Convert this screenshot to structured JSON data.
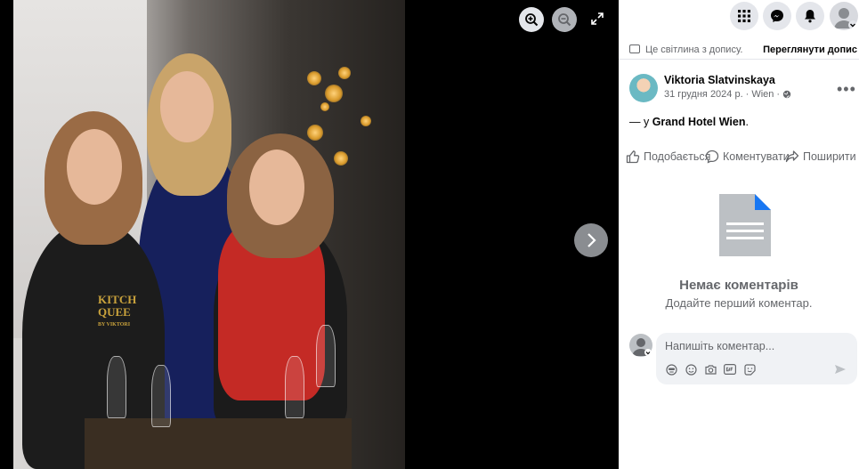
{
  "viewer": {
    "controls": {
      "zoom_in_icon": "zoom-in-icon",
      "zoom_out_icon": "zoom-out-icon",
      "fullscreen_icon": "fullscreen-icon",
      "next_icon": "chevron-right-icon"
    },
    "photo_sign": {
      "brand_line1": "KITCH",
      "brand_line2": "QUEE",
      "brand_line3": "BY VIKTORI"
    }
  },
  "topbar": {
    "icons": [
      "apps-grid-icon",
      "messenger-icon",
      "bell-icon",
      "profile-icon"
    ]
  },
  "notice": {
    "text": "Це світлина з допису.",
    "link": "Переглянути допис"
  },
  "post": {
    "author": "Viktoria Slatvinskaya",
    "date": "31 грудня 2024 р.",
    "separator": "·",
    "location": "Wien",
    "privacy_icon": "globe-icon",
    "text_prefix": "— у ",
    "place": "Grand Hotel Wien",
    "text_suffix": "."
  },
  "actions": {
    "like": "Подобається",
    "comment": "Коментувати",
    "share": "Поширити"
  },
  "comments": {
    "empty_title": "Немає коментарів",
    "empty_subtitle": "Додайте перший коментар.",
    "composer_placeholder": "Напишіть коментар..."
  },
  "colors": {
    "accent": "#1877f2",
    "panel_bg": "#ffffff",
    "viewer_bg": "#000000",
    "muted": "#65676b"
  }
}
